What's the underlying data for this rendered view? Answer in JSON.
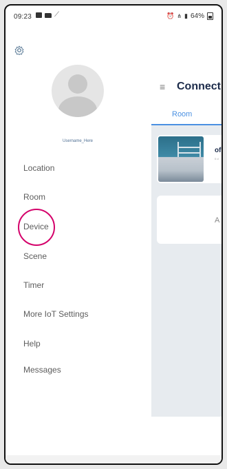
{
  "status_bar": {
    "time": "09:23",
    "right_text": "64%"
  },
  "drawer": {
    "username": "Username_Here",
    "menu_items": [
      {
        "label": "Location"
      },
      {
        "label": "Room"
      },
      {
        "label": "Device"
      },
      {
        "label": "Scene"
      },
      {
        "label": "Timer"
      },
      {
        "label": "More IoT Settings"
      },
      {
        "label": "Help"
      },
      {
        "label": "Messages"
      }
    ]
  },
  "content": {
    "title": "Connect",
    "tab_label": "Room",
    "room_name": "of",
    "room_sub": "0 d",
    "add_text": "A"
  },
  "colors": {
    "accent": "#4a90e2",
    "highlight": "#d4006a",
    "title": "#1c2b4a"
  }
}
